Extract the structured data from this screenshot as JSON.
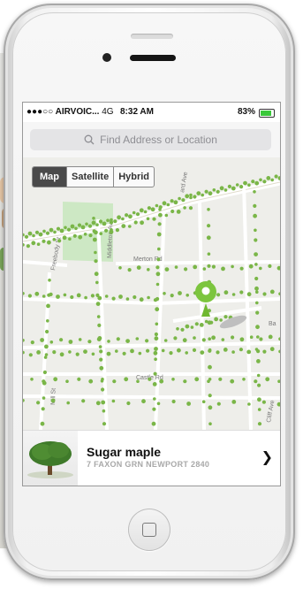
{
  "status": {
    "carrier": "●●●○○ AIRVOIC...",
    "network": "4G",
    "time": "8:32 AM",
    "battery": "83%"
  },
  "search": {
    "placeholder": "Find Address or Location"
  },
  "map_type": {
    "options": [
      "Map",
      "Satellite",
      "Hybrid"
    ],
    "selected": "Map"
  },
  "map": {
    "streets": [
      "Merton Rd",
      "Freebody St",
      "Middleton Ave",
      "ard Ave",
      "Bowler St",
      "Castle Rd",
      "Ave",
      "Cliff Ave",
      "Mill St",
      "Ba"
    ]
  },
  "tree": {
    "name": "Sugar maple",
    "address": "7 FAXON GRN NEWPORT 2840"
  },
  "colors": {
    "accent_green": "#7cc53e",
    "tree_dot": "#7ab648",
    "map_bg": "#eeeeea",
    "park": "#cde8c4"
  }
}
